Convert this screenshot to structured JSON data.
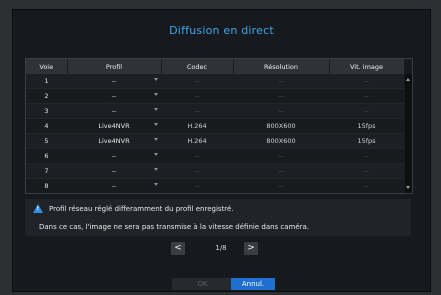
{
  "dialog": {
    "title": "Diffusion en direct"
  },
  "table": {
    "columns": [
      "Voie",
      "Profil",
      "Codec",
      "Résolution",
      "Vit. image"
    ],
    "rows": [
      {
        "voie": "1",
        "profil": "--",
        "codec": "--",
        "resolution": "--",
        "vit": "--"
      },
      {
        "voie": "2",
        "profil": "--",
        "codec": "--",
        "resolution": "--",
        "vit": "--"
      },
      {
        "voie": "3",
        "profil": "--",
        "codec": "--",
        "resolution": "--",
        "vit": "--"
      },
      {
        "voie": "4",
        "profil": "Live4NVR",
        "codec": "H.264",
        "resolution": "800X600",
        "vit": "15fps"
      },
      {
        "voie": "5",
        "profil": "Live4NVR",
        "codec": "H.264",
        "resolution": "800X600",
        "vit": "15fps"
      },
      {
        "voie": "6",
        "profil": "--",
        "codec": "--",
        "resolution": "--",
        "vit": "--"
      },
      {
        "voie": "7",
        "profil": "--",
        "codec": "--",
        "resolution": "--",
        "vit": "--"
      },
      {
        "voie": "8",
        "profil": "--",
        "codec": "--",
        "resolution": "--",
        "vit": "--"
      }
    ]
  },
  "notice": {
    "line1": "Profil réseau réglé differamment du profil enregistré.",
    "line2": "Dans ce cas, l'image ne sera pas transmise à la vitesse définie dans caméra."
  },
  "pager": {
    "prev": "<",
    "next": ">",
    "info": "1/8"
  },
  "buttons": {
    "ok": "OK",
    "cancel": "Annul."
  },
  "colors": {
    "accent": "#3fa7ea",
    "primary_button": "#1f6fd0"
  }
}
